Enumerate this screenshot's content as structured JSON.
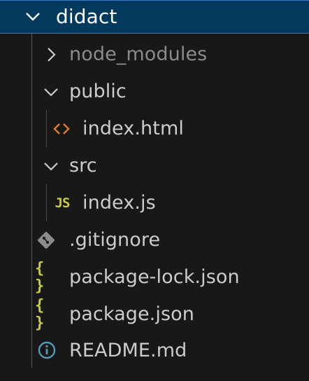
{
  "explorer": {
    "root": {
      "label": "didact",
      "state": "expanded"
    },
    "items": [
      {
        "label": "node_modules",
        "type": "folder",
        "state": "collapsed",
        "dimmed": true
      },
      {
        "label": "public",
        "type": "folder",
        "state": "expanded"
      },
      {
        "label": "index.html",
        "type": "file",
        "icon": "html-icon"
      },
      {
        "label": "src",
        "type": "folder",
        "state": "expanded"
      },
      {
        "label": "index.js",
        "type": "file",
        "icon": "js-icon",
        "icon_text": "JS"
      },
      {
        "label": ".gitignore",
        "type": "file",
        "icon": "git-icon"
      },
      {
        "label": "package-lock.json",
        "type": "file",
        "icon": "json-icon",
        "icon_text": "{ }"
      },
      {
        "label": "package.json",
        "type": "file",
        "icon": "json-icon",
        "icon_text": "{ }"
      },
      {
        "label": "README.md",
        "type": "file",
        "icon": "info-icon"
      }
    ]
  },
  "colors": {
    "background": "#181818",
    "selection": "#04395e",
    "selection_border": "#2f7fc2",
    "text": "#cccccc",
    "dimmed_text": "#8b8b8b",
    "html_icon": "#e37933",
    "js_icon": "#cbcb41",
    "git_icon": "#8b8b8b",
    "info_icon": "#519aba"
  }
}
